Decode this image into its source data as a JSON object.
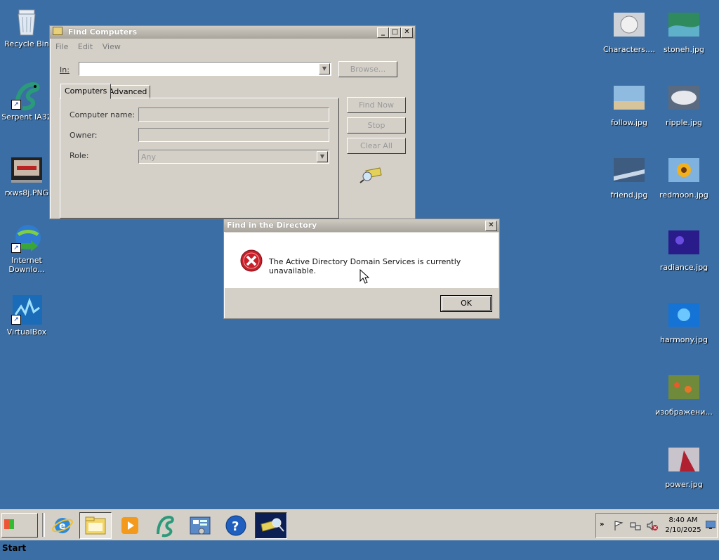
{
  "desktop_left": [
    {
      "label": "Recycle Bin"
    },
    {
      "label": "Serpent IA32"
    },
    {
      "label": "rxws8j.PNG"
    },
    {
      "label": "Internet Downlo..."
    },
    {
      "label": "VirtualBox"
    }
  ],
  "desktop_right": [
    {
      "label": "Characters...."
    },
    {
      "label": "stoneh.jpg"
    },
    {
      "label": "follow.jpg"
    },
    {
      "label": "ripple.jpg"
    },
    {
      "label": "friend.jpg"
    },
    {
      "label": "redmoon.jpg"
    },
    {
      "label": "radiance.jpg"
    },
    {
      "label": "harmony.jpg"
    },
    {
      "label": "изображени..."
    },
    {
      "label": "power.jpg"
    }
  ],
  "find_window": {
    "title": "Find Computers",
    "menu": [
      "File",
      "Edit",
      "View"
    ],
    "in_label": "In:",
    "browse": "Browse...",
    "tabs": [
      "Computers",
      "Advanced"
    ],
    "computer_name_label": "Computer name:",
    "owner_label": "Owner:",
    "role_label": "Role:",
    "role_value": "Any",
    "find_now": "Find Now",
    "stop": "Stop",
    "clear_all": "Clear All"
  },
  "dialog": {
    "title": "Find in the Directory",
    "message": "The Active Directory Domain Services is currently unavailable.",
    "ok": "OK"
  },
  "taskbar": {
    "start": "Start",
    "time": "8:40 AM",
    "date": "2/10/2025"
  }
}
